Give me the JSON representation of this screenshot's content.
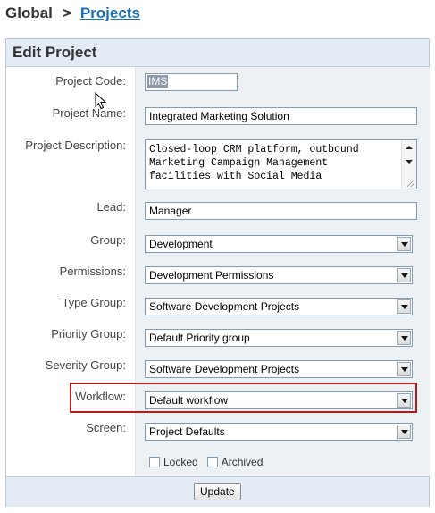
{
  "breadcrumb": {
    "root": "Global",
    "separator": ">",
    "current": "Projects"
  },
  "form": {
    "title": "Edit Project",
    "fields": {
      "project_code": {
        "label": "Project Code:",
        "value": "IMS"
      },
      "project_name": {
        "label": "Project Name:",
        "value": "Integrated Marketing Solution"
      },
      "project_description": {
        "label": "Project Description:",
        "lines": [
          "Closed-loop CRM platform, outbound",
          "Marketing Campaign Management",
          "facilities with Social Media"
        ]
      },
      "lead": {
        "label": "Lead:",
        "value": "Manager"
      },
      "group": {
        "label": "Group:",
        "value": "Development"
      },
      "permissions": {
        "label": "Permissions:",
        "value": "Development Permissions"
      },
      "type_group": {
        "label": "Type Group:",
        "value": "Software Development Projects"
      },
      "priority_group": {
        "label": "Priority Group:",
        "value": "Default Priority group"
      },
      "severity_group": {
        "label": "Severity Group:",
        "value": "Software Development Projects"
      },
      "workflow": {
        "label": "Workflow:",
        "value": "Default workflow"
      },
      "screen": {
        "label": "Screen:",
        "value": "Project Defaults"
      }
    },
    "checkboxes": {
      "locked": {
        "label": "Locked",
        "checked": false
      },
      "archived": {
        "label": "Archived",
        "checked": false
      }
    },
    "update_label": "Update"
  },
  "colors": {
    "header_bg": "#e3ebf5",
    "field_column_bg": "#eef1f4",
    "link": "#1a6fb3",
    "highlight_border": "#b41c1c"
  },
  "icons": [
    "mouse-pointer-icon",
    "chevron-down-icon",
    "resize-grip-icon"
  ]
}
